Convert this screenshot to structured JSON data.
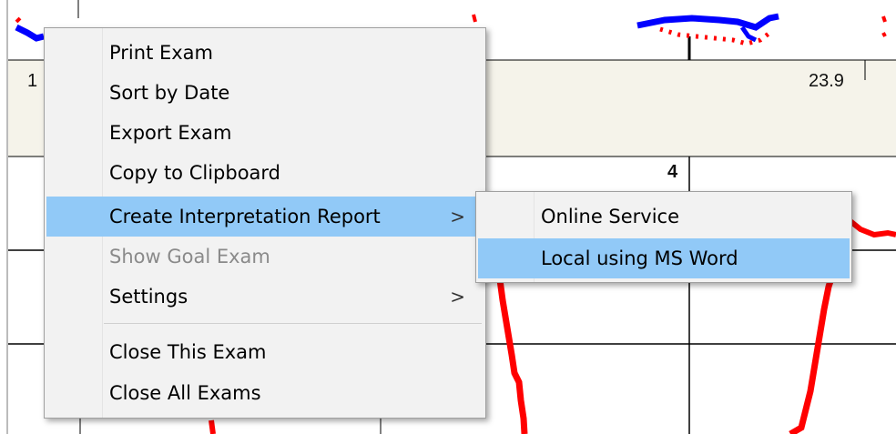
{
  "background": {
    "info_value": "23.9",
    "info_left_char": "1",
    "column_label": "4"
  },
  "context_menu": {
    "items": [
      {
        "label": "Print Exam",
        "state": "normal"
      },
      {
        "label": "Sort by Date",
        "state": "normal"
      },
      {
        "label": "Export Exam",
        "state": "normal"
      },
      {
        "label": "Copy to Clipboard",
        "state": "normal"
      },
      {
        "label": "Create Interpretation Report",
        "state": "highlighted",
        "submenu_arrow": ">"
      },
      {
        "label": "Show Goal Exam",
        "state": "disabled"
      },
      {
        "label": "Settings",
        "state": "normal",
        "submenu_arrow": ">"
      },
      {
        "label": "Close This Exam",
        "state": "normal"
      },
      {
        "label": "Close All Exams",
        "state": "normal"
      }
    ]
  },
  "submenu": {
    "items": [
      {
        "label": "Online Service",
        "state": "normal"
      },
      {
        "label": "Local using MS Word",
        "state": "highlighted"
      }
    ]
  },
  "colors": {
    "highlight": "#91c9f7",
    "menu_bg": "#f2f2f2",
    "trace_red": "#ff0000",
    "trace_blue": "#0000ff",
    "info_band": "#f5f3ea"
  }
}
